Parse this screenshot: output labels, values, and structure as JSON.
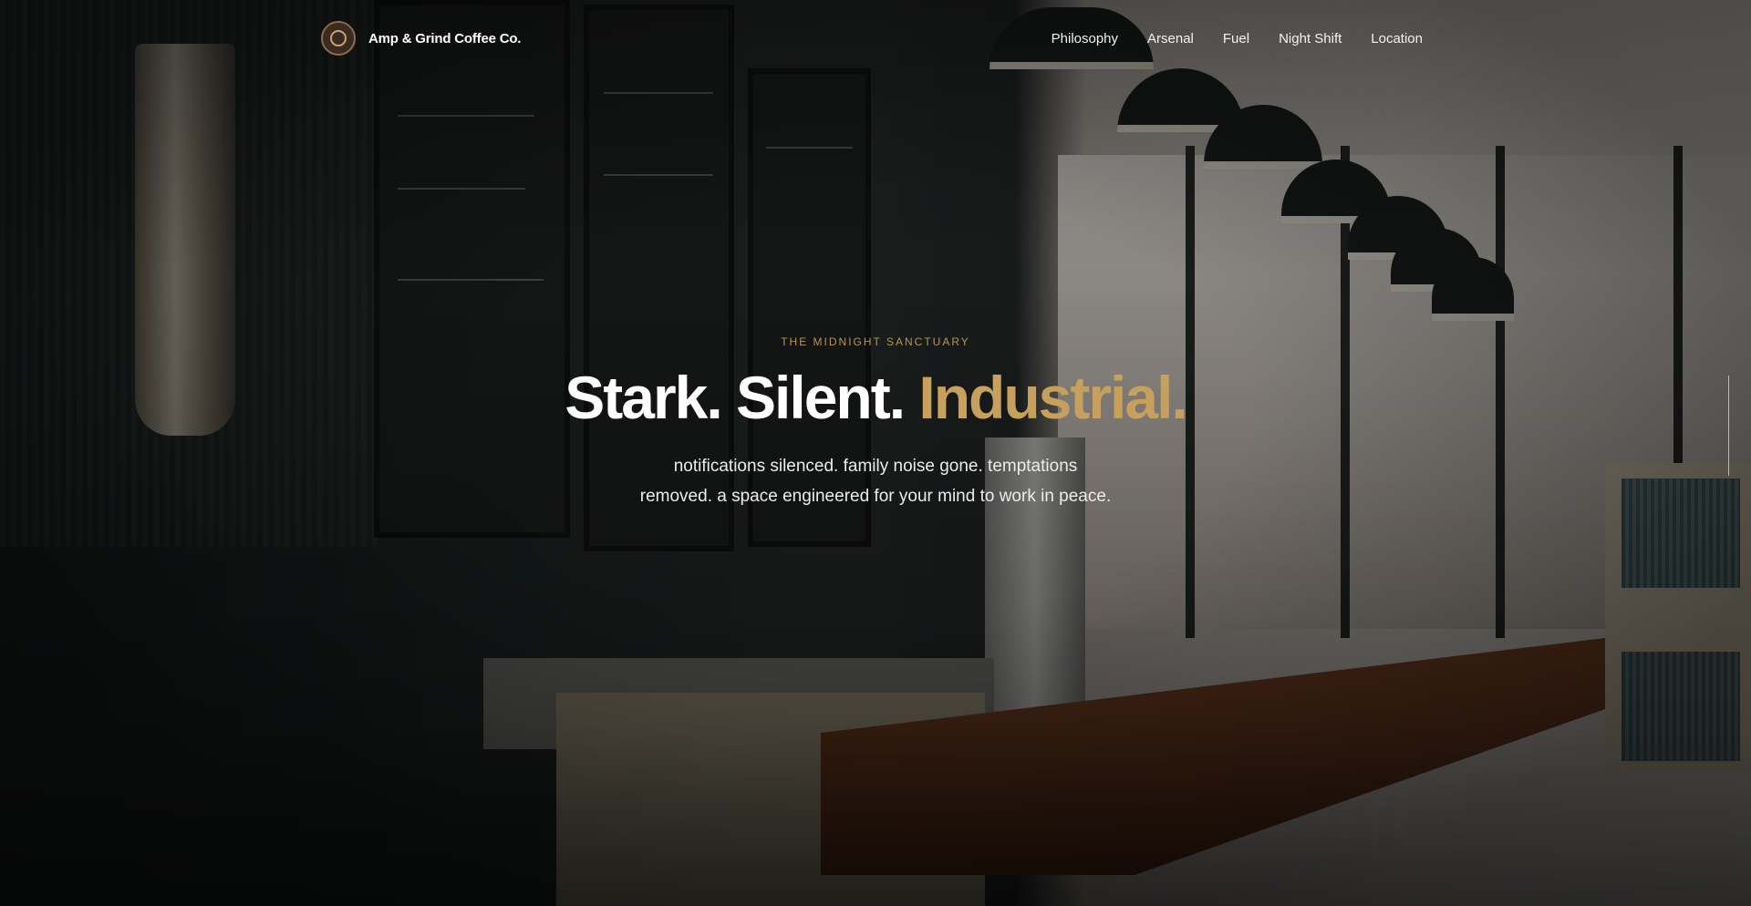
{
  "brand": {
    "name": "Amp & Grind Coffee Co.",
    "logo_icon": "coffee-badge-icon"
  },
  "nav": {
    "links": [
      "Philosophy",
      "Arsenal",
      "Fuel",
      "Night Shift",
      "Location"
    ]
  },
  "hero": {
    "eyebrow": "The Midnight Sanctuary",
    "headline_main": "Stark. Silent.",
    "headline_accent": "Industrial.",
    "subtitle": "notifications silenced. family noise gone. temptations removed. a space engineered for your mind to work in peace."
  },
  "colors": {
    "accent": "#c6a05c",
    "text": "#ffffff",
    "background": "#141414"
  }
}
